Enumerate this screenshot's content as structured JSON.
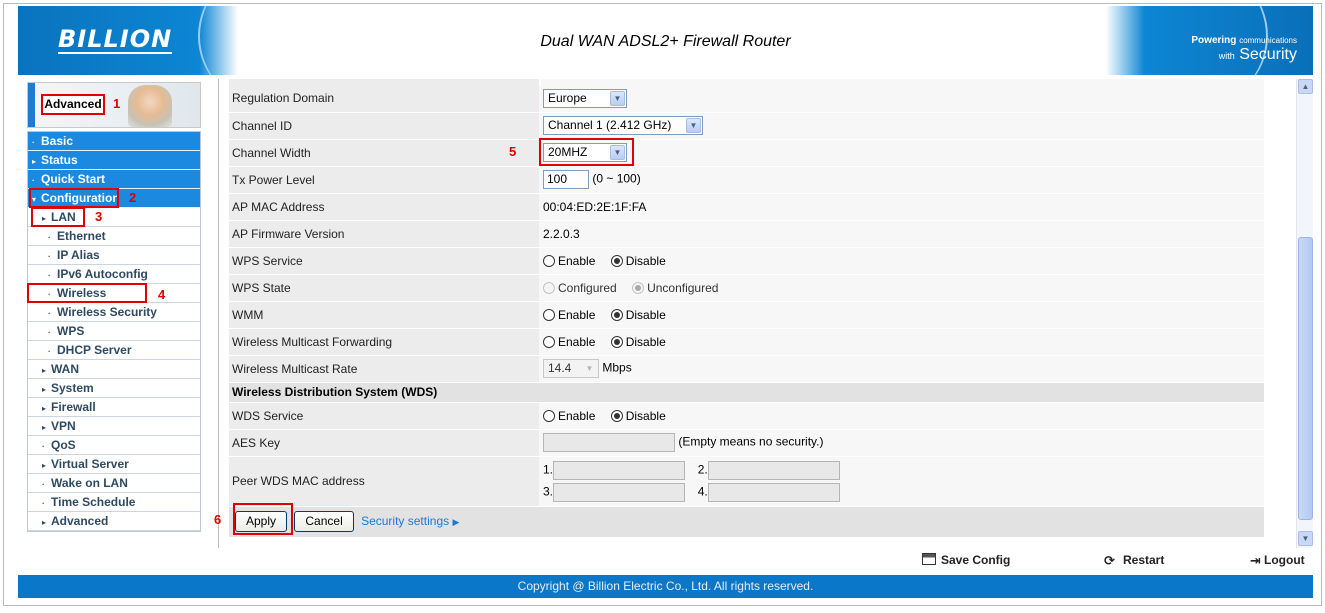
{
  "header": {
    "logo": "BILLION",
    "title": "Dual WAN ADSL2+ Firewall Router",
    "tagline_main": "Powering",
    "tagline_small": "communications",
    "tagline_with": "with",
    "tagline_brand": "Security"
  },
  "sidebar": {
    "mode_label": "Advanced",
    "menu": [
      {
        "label": "Basic",
        "glyph": "·",
        "level": "top"
      },
      {
        "label": "Status",
        "glyph": "▸",
        "level": "top"
      },
      {
        "label": "Quick Start",
        "glyph": "·",
        "level": "top"
      },
      {
        "label": "Configuration",
        "glyph": "▾",
        "level": "top"
      },
      {
        "label": "LAN",
        "glyph": "▸",
        "level": "l1"
      },
      {
        "label": "Ethernet",
        "glyph": "·",
        "level": "l2"
      },
      {
        "label": "IP Alias",
        "glyph": "·",
        "level": "l2"
      },
      {
        "label": "IPv6 Autoconfig",
        "glyph": "·",
        "level": "l2"
      },
      {
        "label": "Wireless",
        "glyph": "·",
        "level": "l2"
      },
      {
        "label": "Wireless Security",
        "glyph": "·",
        "level": "l2"
      },
      {
        "label": "WPS",
        "glyph": "·",
        "level": "l2"
      },
      {
        "label": "DHCP Server",
        "glyph": "·",
        "level": "l2"
      },
      {
        "label": "WAN",
        "glyph": "▸",
        "level": "l1"
      },
      {
        "label": "System",
        "glyph": "▸",
        "level": "l1"
      },
      {
        "label": "Firewall",
        "glyph": "▸",
        "level": "l1"
      },
      {
        "label": "VPN",
        "glyph": "▸",
        "level": "l1"
      },
      {
        "label": "QoS",
        "glyph": "·",
        "level": "l1"
      },
      {
        "label": "Virtual Server",
        "glyph": "▸",
        "level": "l1"
      },
      {
        "label": "Wake on LAN",
        "glyph": "·",
        "level": "l1"
      },
      {
        "label": "Time Schedule",
        "glyph": "·",
        "level": "l1"
      },
      {
        "label": "Advanced",
        "glyph": "▸",
        "level": "l1"
      }
    ]
  },
  "callouts": [
    "1",
    "2",
    "3",
    "4",
    "5",
    "6"
  ],
  "form": {
    "regulation_domain": {
      "label": "Regulation Domain",
      "value": "Europe"
    },
    "channel_id": {
      "label": "Channel ID",
      "value": "Channel 1 (2.412 GHz)"
    },
    "channel_width": {
      "label": "Channel Width",
      "value": "20MHZ"
    },
    "tx_power": {
      "label": "Tx Power Level",
      "value": "100",
      "hint": "(0 ~ 100)"
    },
    "ap_mac": {
      "label": "AP MAC Address",
      "value": "00:04:ED:2E:1F:FA"
    },
    "ap_fw": {
      "label": "AP Firmware Version",
      "value": "2.2.0.3"
    },
    "wps_service": {
      "label": "WPS Service",
      "opt1": "Enable",
      "opt2": "Disable"
    },
    "wps_state": {
      "label": "WPS State",
      "opt1": "Configured",
      "opt2": "Unconfigured"
    },
    "wmm": {
      "label": "WMM",
      "opt1": "Enable",
      "opt2": "Disable"
    },
    "multicast_fwd": {
      "label": "Wireless Multicast Forwarding",
      "opt1": "Enable",
      "opt2": "Disable"
    },
    "multicast_rate": {
      "label": "Wireless Multicast Rate",
      "value": "14.4",
      "unit": "Mbps"
    },
    "wds_section": "Wireless Distribution System (WDS)",
    "wds_service": {
      "label": "WDS Service",
      "opt1": "Enable",
      "opt2": "Disable"
    },
    "aes_key": {
      "label": "AES Key",
      "value": "",
      "hint": "(Empty means no security.)"
    },
    "peer_mac": {
      "label": "Peer WDS MAC address",
      "n1": "1.",
      "n2": "2.",
      "n3": "3.",
      "n4": "4.",
      "v1": "",
      "v2": "",
      "v3": "",
      "v4": ""
    },
    "apply_label": "Apply",
    "cancel_label": "Cancel",
    "security_link": "Security settings"
  },
  "actions": {
    "save": "Save Config",
    "restart": "Restart",
    "logout": "Logout"
  },
  "footer": "Copyright @ Billion Electric Co., Ltd. All rights reserved."
}
